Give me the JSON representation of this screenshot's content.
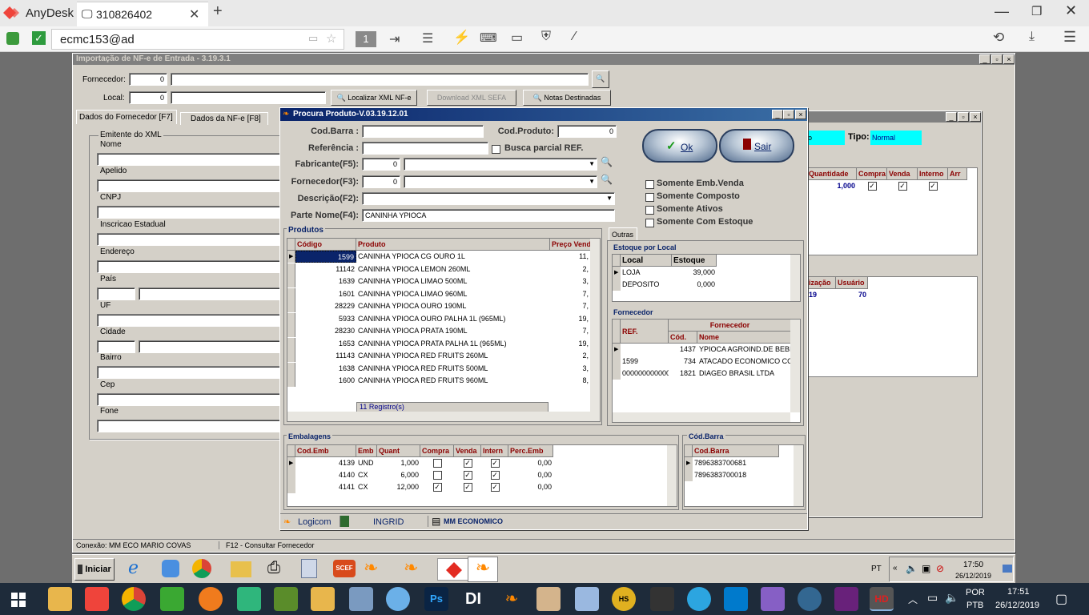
{
  "anydesk": {
    "app_name": "AnyDesk",
    "tab_label": "310826402",
    "address": "ecmc153@ad",
    "badge_num": "1"
  },
  "main_window": {
    "title": "Importação de NF-e de Entrada - 3.19.3.1",
    "fornecedor_label": "Fornecedor:",
    "fornecedor_code": "0",
    "local_label": "Local:",
    "local_code": "0",
    "btn_localizar": "Localizar XML NF-e",
    "btn_download": "Download XML SEFA",
    "btn_notas": "Notas Destinadas",
    "tabs": [
      "Dados do Fornecedor [F7]",
      "Dados da NF-e  [F8]"
    ],
    "group_title": "Emitente do XML",
    "fields": [
      "Nome",
      "Apelido",
      "CNPJ",
      "Inscricao Estadual",
      "Endereço",
      "País",
      "UF",
      "Cidade",
      "Bairro",
      "Cep",
      "Fone"
    ],
    "status_left": "Conexão: MM ECO MARIO COVAS",
    "status_right": "F12 - Consultar Fornecedor"
  },
  "back_window": {
    "tipo_label": "Tipo:",
    "tipo_value": "Normal",
    "left_cyan": "o",
    "cols": [
      "Quantidade",
      "Compra",
      "Venda",
      "Interno",
      "Arr"
    ],
    "row_qty": "1,000",
    "cols2": [
      "ização",
      "Usuário"
    ],
    "row2": [
      "19",
      "70"
    ]
  },
  "dialog": {
    "title": "Procura Produto-V.03.19.12.01",
    "cod_barra_label": "Cod.Barra :",
    "cod_produto_label": "Cod.Produto:",
    "cod_produto_value": "0",
    "referencia_label": "Referência :",
    "busca_parcial": "Busca parcial REF.",
    "fabricante_label": "Fabricante(F5):",
    "fabricante_value": "0",
    "fornecedor_label": "Fornecedor(F3):",
    "fornecedor_value": "0",
    "descricao_label": "Descrição(F2):",
    "parte_nome_label": "Parte Nome(F4):",
    "parte_nome_value": "CANINHA YPIOCA",
    "ok_label": "Ok",
    "sair_label": "Sair",
    "checks": [
      "Somente Emb.Venda",
      "Somente Composto",
      "Somente Ativos",
      "Somente Com Estoque"
    ],
    "produtos_title": "Produtos",
    "produtos_cols": [
      "Código",
      "Produto",
      "Preço Venda"
    ],
    "produtos": [
      {
        "codigo": "1599",
        "produto": "CANINHA YPIOCA CG OURO 1L",
        "preco": "11,"
      },
      {
        "codigo": "11142",
        "produto": "CANINHA YPIOCA LEMON 260ML",
        "preco": "2,"
      },
      {
        "codigo": "1639",
        "produto": "CANINHA YPIOCA LIMAO 500ML",
        "preco": "3,"
      },
      {
        "codigo": "1601",
        "produto": "CANINHA YPIOCA LIMAO 960ML",
        "preco": "7,"
      },
      {
        "codigo": "28229",
        "produto": "CANINHA YPIOCA OURO 190ML",
        "preco": "7,"
      },
      {
        "codigo": "5933",
        "produto": "CANINHA YPIOCA OURO PALHA 1L (965ML)",
        "preco": "19,"
      },
      {
        "codigo": "28230",
        "produto": "CANINHA YPIOCA PRATA 190ML",
        "preco": "7,"
      },
      {
        "codigo": "1653",
        "produto": "CANINHA YPIOCA PRATA PALHA 1L (965ML)",
        "preco": "19,"
      },
      {
        "codigo": "11143",
        "produto": "CANINHA YPIOCA RED FRUITS 260ML",
        "preco": "2,"
      },
      {
        "codigo": "1638",
        "produto": "CANINHA YPIOCA RED FRUITS 500ML",
        "preco": "3,"
      },
      {
        "codigo": "1600",
        "produto": "CANINHA YPIOCA RED FRUITS 960ML",
        "preco": "8,"
      }
    ],
    "registros": "11  Registro(s)",
    "outras_tab": "Outras",
    "estoque_title": "Estoque por Local",
    "estoque_cols": [
      "Local",
      "Estoque"
    ],
    "estoque": [
      {
        "local": "LOJA",
        "estoque": "39,000"
      },
      {
        "local": "DEPOSITO",
        "estoque": "0,000"
      }
    ],
    "fornecedor_title": "Fornecedor",
    "forn_cols": [
      "REF.",
      "Fornecedor",
      "Cód.",
      "Nome"
    ],
    "fornecedores": [
      {
        "ref": "",
        "cod": "1437",
        "nome": "YPIOCA AGROIND.DE BEBID"
      },
      {
        "ref": "1599",
        "cod": "734",
        "nome": "ATACADO ECONOMICO CO"
      },
      {
        "ref": "000000000000",
        "cod": "1821",
        "nome": "DIAGEO BRASIL LTDA"
      }
    ],
    "emb_title": "Embalagens",
    "emb_cols": [
      "Cod.Emb",
      "Emb",
      "Quant",
      "Compra",
      "Venda",
      "Intern",
      "Perc.Emb"
    ],
    "embalagens": [
      {
        "cod": "4139",
        "emb": "UND",
        "quant": "1,000",
        "compra": false,
        "venda": true,
        "intern": true,
        "perc": "0,00"
      },
      {
        "cod": "4140",
        "emb": "CX",
        "quant": "6,000",
        "compra": false,
        "venda": true,
        "intern": true,
        "perc": "0,00"
      },
      {
        "cod": "4141",
        "emb": "CX",
        "quant": "12,000",
        "compra": true,
        "venda": true,
        "intern": true,
        "perc": "0,00"
      }
    ],
    "codbarra_title": "Cód.Barra",
    "codbarra_col": "Cod.Barra",
    "codbarras": [
      "7896383700681",
      "7896383700018"
    ],
    "status": [
      "Logicom",
      "INGRID",
      "MM ECONOMICO"
    ]
  },
  "xp_taskbar": {
    "start": "Iniciar",
    "lang": "PT",
    "time": "17:50",
    "date": "26/12/2019"
  },
  "win10": {
    "lang1": "POR",
    "lang2": "PTB",
    "time": "17:51",
    "date": "26/12/2019"
  },
  "colors": {
    "anydesk_red": "#ef443b",
    "title_blue": "#0a246a",
    "cyan": "#00ffff"
  }
}
